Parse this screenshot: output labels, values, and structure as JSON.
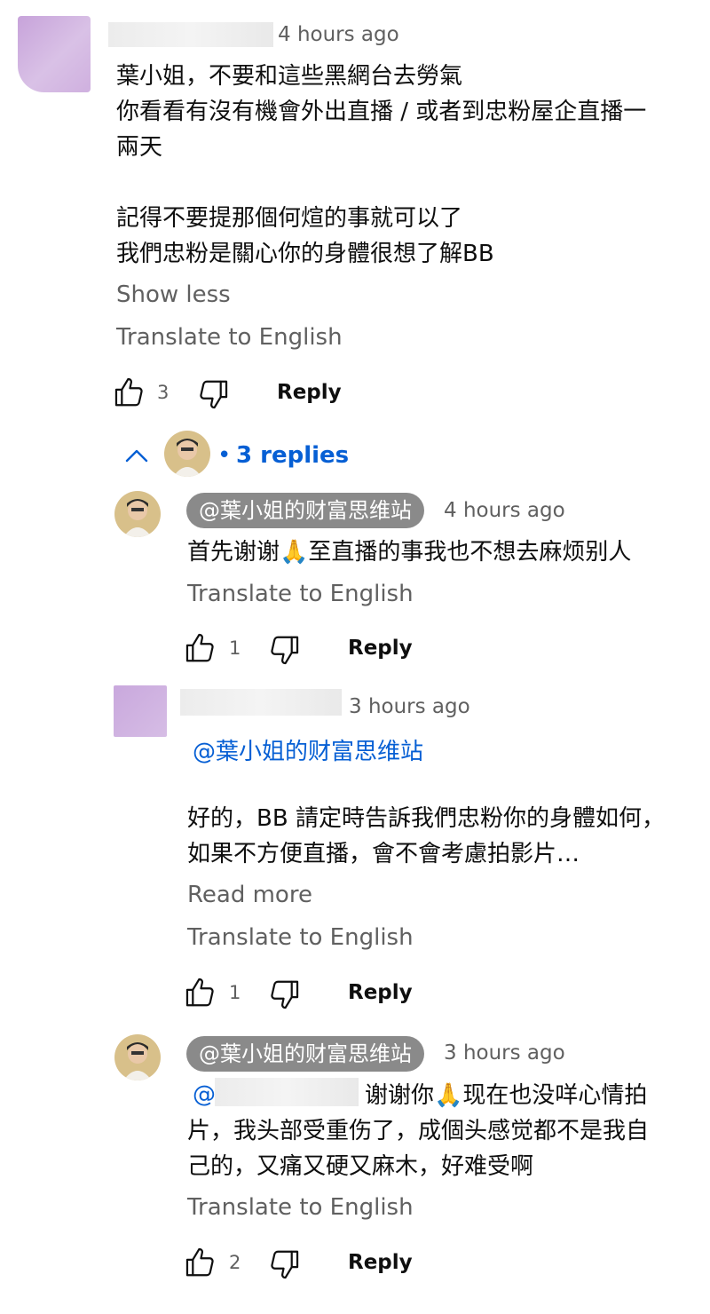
{
  "top_comment": {
    "time": "4 hours ago",
    "lines": "葉小姐，不要和這些黑網台去勞氣\n你看看有沒有機會外出直播 / 或者到忠粉屋企直播一\n兩天\n\n記得不要提那個何煊的事就可以了\n我們忠粉是關心你的身體很想了解BB",
    "show_less": "Show less",
    "translate": "Translate to English",
    "likes": "3",
    "reply": "Reply"
  },
  "replies_toggle": {
    "dot": "•",
    "label": "3 replies"
  },
  "replies": [
    {
      "author": "@葉小姐的财富思维站",
      "time": "4 hours ago",
      "text": "首先谢谢🙏至直播的事我也不想去麻烦别人",
      "translate": "Translate to English",
      "likes": "1",
      "reply": "Reply"
    },
    {
      "time": "3 hours ago",
      "mention": "@葉小姐的财富思维站",
      "text": "好的，BB 請定時告訴我們忠粉你的身體如何，\n如果不方便直播，會不會考慮拍影片…",
      "read_more": "Read more",
      "translate": "Translate to English",
      "likes": "1",
      "reply": "Reply"
    },
    {
      "author": "@葉小姐的财富思维站",
      "time": "3 hours ago",
      "mention": "@",
      "text_first": "谢谢你🙏现在也没咩心情拍",
      "text_rest": "片，我头部受重伤了，成個头感觉都不是我自\n己的，又痛又硬又麻木，好难受啊",
      "translate": "Translate to English",
      "likes": "2",
      "reply": "Reply"
    }
  ],
  "colors": {
    "link_blue": "#065fd4",
    "secondary_gray": "#606060",
    "chip_gray": "#8a8a8a",
    "blur_purple": "#c8a6dc"
  }
}
